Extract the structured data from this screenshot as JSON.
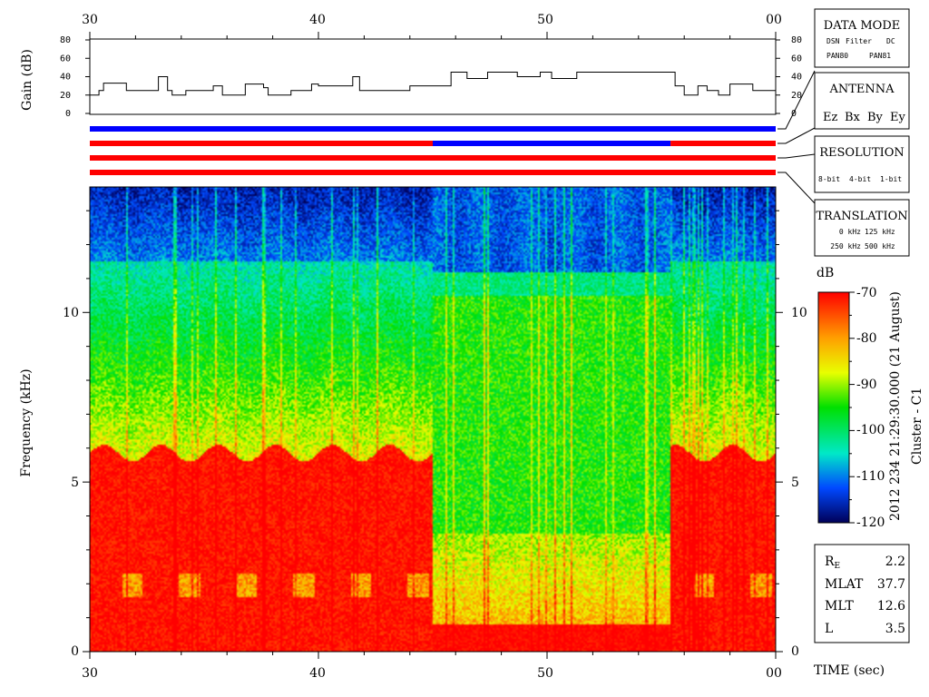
{
  "chart_data": {
    "type": "heatmap",
    "time_axis": {
      "label": "TIME (sec)",
      "ticks": [
        "30",
        "40",
        "50",
        "00"
      ],
      "range_sec": [
        30,
        60
      ]
    },
    "gain_panel": {
      "ylabel": "Gain (dB)",
      "yticks": [
        "0",
        "20",
        "40",
        "60",
        "80"
      ],
      "ylim": [
        0,
        80
      ],
      "profile": [
        [
          30.0,
          20
        ],
        [
          30.4,
          25
        ],
        [
          30.6,
          33
        ],
        [
          31.5,
          33
        ],
        [
          31.6,
          25
        ],
        [
          32.6,
          25
        ],
        [
          33.0,
          40
        ],
        [
          33.4,
          25
        ],
        [
          33.6,
          20
        ],
        [
          34.1,
          20
        ],
        [
          34.2,
          25
        ],
        [
          35.2,
          25
        ],
        [
          35.4,
          30
        ],
        [
          35.8,
          20
        ],
        [
          36.4,
          20
        ],
        [
          36.8,
          32
        ],
        [
          37.5,
          32
        ],
        [
          37.6,
          28
        ],
        [
          37.8,
          20
        ],
        [
          38.5,
          20
        ],
        [
          38.8,
          25
        ],
        [
          39.5,
          25
        ],
        [
          39.7,
          32
        ],
        [
          40.0,
          30
        ],
        [
          41.2,
          30
        ],
        [
          41.5,
          40
        ],
        [
          41.8,
          25
        ],
        [
          43.5,
          25
        ],
        [
          44.0,
          30
        ],
        [
          45.2,
          30
        ],
        [
          45.8,
          45
        ],
        [
          46.2,
          45
        ],
        [
          46.5,
          38
        ],
        [
          47.0,
          38
        ],
        [
          47.4,
          45
        ],
        [
          48.5,
          45
        ],
        [
          48.7,
          40
        ],
        [
          49.4,
          40
        ],
        [
          49.7,
          45
        ],
        [
          50.0,
          45
        ],
        [
          50.2,
          38
        ],
        [
          51.0,
          38
        ],
        [
          51.3,
          45
        ],
        [
          55.2,
          45
        ],
        [
          55.6,
          30
        ],
        [
          56.0,
          20
        ],
        [
          56.6,
          30
        ],
        [
          57.0,
          25
        ],
        [
          57.5,
          20
        ],
        [
          58.0,
          32
        ],
        [
          58.6,
          32
        ],
        [
          59.0,
          25
        ],
        [
          60.0,
          25
        ]
      ]
    },
    "side_panels": {
      "data_mode": {
        "title": "DATA MODE",
        "items": [
          {
            "label": "DSN",
            "color": "#ff0000"
          },
          {
            "label": "Filter",
            "color": "#00cc00"
          },
          {
            "label": "DC",
            "color": "#0000ff"
          },
          {
            "label": "PAN80",
            "color": "#000000"
          },
          {
            "label": "PAN81",
            "color": "#00cccc"
          }
        ]
      },
      "antenna": {
        "title": "ANTENNA",
        "items": [
          {
            "label": "Ez",
            "color": "#ff0000"
          },
          {
            "label": "Bx",
            "color": "#00cc00"
          },
          {
            "label": "By",
            "color": "#0000ff"
          },
          {
            "label": "Ey",
            "color": "#000000"
          }
        ]
      },
      "resolution": {
        "title": "RESOLUTION",
        "items": [
          {
            "label": "8-bit",
            "color": "#ff0000"
          },
          {
            "label": "4-bit",
            "color": "#00cc00"
          },
          {
            "label": "1-bit",
            "color": "#0000ff"
          }
        ]
      },
      "translation": {
        "title": "TRANSLATION",
        "items": [
          {
            "label": "0 kHz",
            "color": "#ff0000"
          },
          {
            "label": "125 kHz",
            "color": "#00cc00"
          },
          {
            "label": "250 kHz",
            "color": "#0000ff"
          },
          {
            "label": "500 kHz",
            "color": "#000000"
          }
        ]
      }
    },
    "status_bars": [
      {
        "name": "data_mode",
        "segments": [
          {
            "from": 30,
            "to": 60,
            "color": "#0000ff"
          }
        ]
      },
      {
        "name": "antenna",
        "segments": [
          {
            "from": 30,
            "to": 45,
            "color": "#ff0000"
          },
          {
            "from": 45,
            "to": 55.4,
            "color": "#0000ff"
          },
          {
            "from": 55.4,
            "to": 60,
            "color": "#ff0000"
          }
        ]
      },
      {
        "name": "resolution",
        "segments": [
          {
            "from": 30,
            "to": 60,
            "color": "#ff0000"
          }
        ]
      },
      {
        "name": "translation",
        "segments": [
          {
            "from": 30,
            "to": 60,
            "color": "#ff0000"
          }
        ]
      }
    ],
    "spectrogram": {
      "ylabel": "Frequency (kHz)",
      "yticks": [
        "0",
        "5",
        "10"
      ],
      "ylim_khz": [
        0,
        13.7
      ],
      "color_scale": {
        "unit": "dB",
        "range": [
          -120,
          -70
        ],
        "ticks": [
          "-70",
          "-80",
          "-90",
          "-100",
          "-110",
          "-120"
        ]
      },
      "regions": [
        {
          "t_from": 30,
          "t_to": 45,
          "note": "strong emission below ~6 kHz, bursts every ~2.5 s"
        },
        {
          "t_from": 45,
          "t_to": 55.4,
          "note": "emission confined below ~0.8 kHz; weak above ~11 kHz"
        },
        {
          "t_from": 55.4,
          "t_to": 60,
          "note": "strong emission below ~6 kHz"
        }
      ]
    },
    "right_label": "2012 234  21:29:30.000 (21 August)",
    "spacecraft": "Cluster - C1",
    "ephemeris": [
      {
        "label": "R",
        "sub": "E",
        "value": "2.2"
      },
      {
        "label": "MLAT",
        "sub": "",
        "value": "37.7"
      },
      {
        "label": "MLT",
        "sub": "",
        "value": "12.6"
      },
      {
        "label": "L",
        "sub": "",
        "value": "3.5"
      }
    ]
  }
}
